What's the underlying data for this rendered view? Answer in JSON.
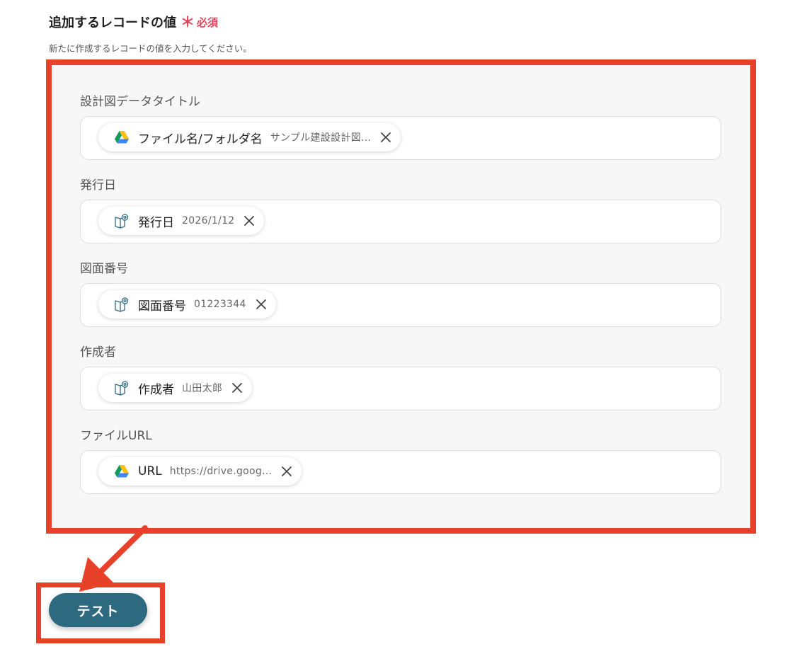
{
  "section": {
    "title": "追加するレコードの値",
    "required_mark": "＊",
    "required_label": "必須",
    "description": "新たに作成するレコードの値を入力してください。"
  },
  "fields": [
    {
      "label": "設計図データタイトル",
      "chip": {
        "source": "google-drive",
        "name": "ファイル名/フォルダ名",
        "value": "サンプル建設設計図..."
      }
    },
    {
      "label": "発行日",
      "chip": {
        "source": "ocr-book",
        "name": "発行日",
        "value": "2026/1/12"
      }
    },
    {
      "label": "図面番号",
      "chip": {
        "source": "ocr-book",
        "name": "図面番号",
        "value": "01223344"
      }
    },
    {
      "label": "作成者",
      "chip": {
        "source": "ocr-book",
        "name": "作成者",
        "value": "山田太郎"
      }
    },
    {
      "label": "ファイルURL",
      "chip": {
        "source": "google-drive",
        "name": "URL",
        "value": "https://drive.goog..."
      }
    }
  ],
  "test_button": {
    "label": "テスト"
  },
  "colors": {
    "highlight": "#e8412a",
    "required": "#e0455a",
    "button": "#2d6a80",
    "panel": "#f7f7f7"
  }
}
